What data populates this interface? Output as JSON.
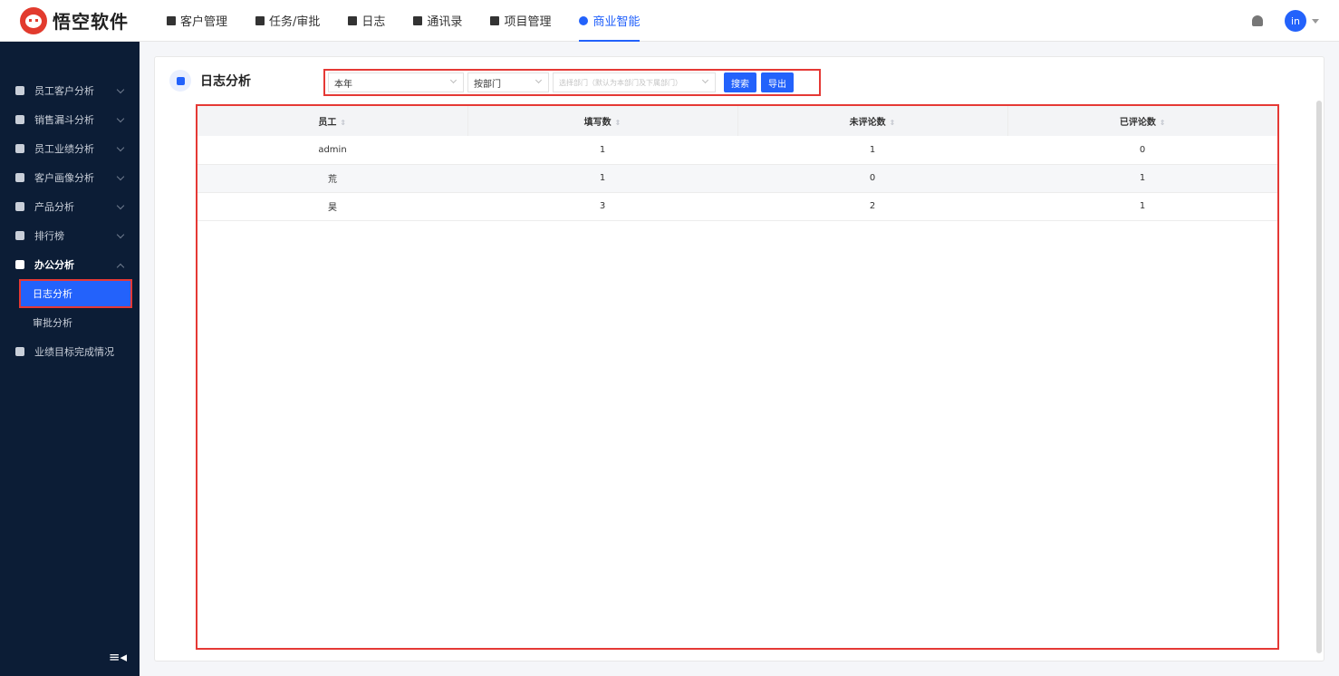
{
  "brand": {
    "name": "悟空软件"
  },
  "nav": [
    {
      "label": "客户管理",
      "icon": "building-icon"
    },
    {
      "label": "任务/审批",
      "icon": "briefcase-icon"
    },
    {
      "label": "日志",
      "icon": "document-icon"
    },
    {
      "label": "通讯录",
      "icon": "contacts-icon"
    },
    {
      "label": "项目管理",
      "icon": "list-icon"
    },
    {
      "label": "商业智能",
      "icon": "shield-icon",
      "active": true
    }
  ],
  "user": {
    "avatar_text": "in"
  },
  "sidebar": {
    "items": [
      {
        "label": "员工客户分析",
        "icon": "user-icon"
      },
      {
        "label": "销售漏斗分析",
        "icon": "funnel-icon"
      },
      {
        "label": "员工业绩分析",
        "icon": "bar-chart-icon"
      },
      {
        "label": "客户画像分析",
        "icon": "users-icon"
      },
      {
        "label": "产品分析",
        "icon": "box-icon"
      },
      {
        "label": "排行榜",
        "icon": "trophy-icon"
      },
      {
        "label": "办公分析",
        "icon": "briefcase-icon",
        "open": true
      }
    ],
    "sub_items": [
      {
        "label": "日志分析",
        "active": true
      },
      {
        "label": "审批分析"
      }
    ],
    "extra_item": {
      "label": "业绩目标完成情况",
      "icon": "target-icon"
    },
    "collapse_icon": "≡◂"
  },
  "page": {
    "title": "日志分析",
    "filters": {
      "year_value": "本年",
      "dept_value": "按部门",
      "dept_placeholder": "选择部门（默认为本部门及下属部门）",
      "search_label": "搜索",
      "export_label": "导出"
    }
  },
  "table": {
    "columns": [
      "员工",
      "填写数",
      "未评论数",
      "已评论数"
    ],
    "sort_glyph": "⇕",
    "rows": [
      [
        "admin",
        "1",
        "1",
        "0"
      ],
      [
        "荒",
        "1",
        "0",
        "1"
      ],
      [
        "昊",
        "3",
        "2",
        "1"
      ]
    ]
  },
  "colors": {
    "accent": "#2362fb",
    "sidebar_bg": "#0c1d36",
    "highlight_border": "#e53935"
  }
}
